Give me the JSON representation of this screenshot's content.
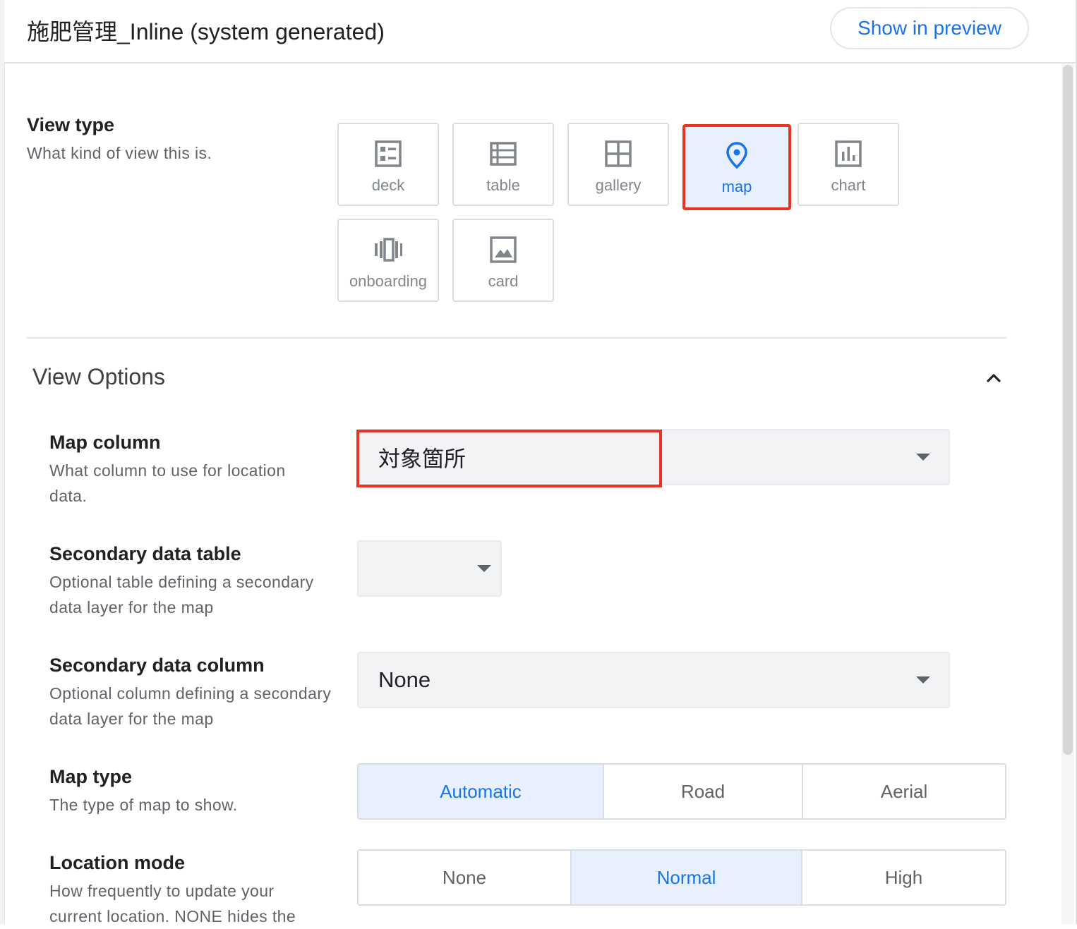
{
  "header": {
    "title": "施肥管理_Inline (system generated)",
    "preview_button": "Show in preview"
  },
  "view_type": {
    "title": "View type",
    "description": "What kind of view this is.",
    "selected": "map",
    "options": [
      {
        "label": "deck",
        "icon": "deck-icon"
      },
      {
        "label": "table",
        "icon": "table-icon"
      },
      {
        "label": "gallery",
        "icon": "gallery-icon"
      },
      {
        "label": "map",
        "icon": "map-pin-icon"
      },
      {
        "label": "chart",
        "icon": "chart-icon"
      },
      {
        "label": "onboarding",
        "icon": "onboarding-icon"
      },
      {
        "label": "card",
        "icon": "card-icon"
      }
    ]
  },
  "view_options": {
    "title": "View Options",
    "map_column": {
      "title": "Map column",
      "description": "What column to use for location data.",
      "value": "対象箇所"
    },
    "secondary_table": {
      "title": "Secondary data table",
      "description": "Optional table defining a secondary data layer for the map",
      "value": ""
    },
    "secondary_column": {
      "title": "Secondary data column",
      "description": "Optional column defining a secondary data layer for the map",
      "value": "None"
    },
    "map_type": {
      "title": "Map type",
      "description": "The type of map to show.",
      "selected": "Automatic",
      "options": [
        "Automatic",
        "Road",
        "Aerial"
      ]
    },
    "location_mode": {
      "title": "Location mode",
      "description": "How frequently to update your current location. NONE hides the",
      "selected": "Normal",
      "options": [
        "None",
        "Normal",
        "High"
      ]
    }
  },
  "colors": {
    "accent": "#1a73e8",
    "selected_bg": "#e8f0fe",
    "highlight": "#ea3323"
  }
}
